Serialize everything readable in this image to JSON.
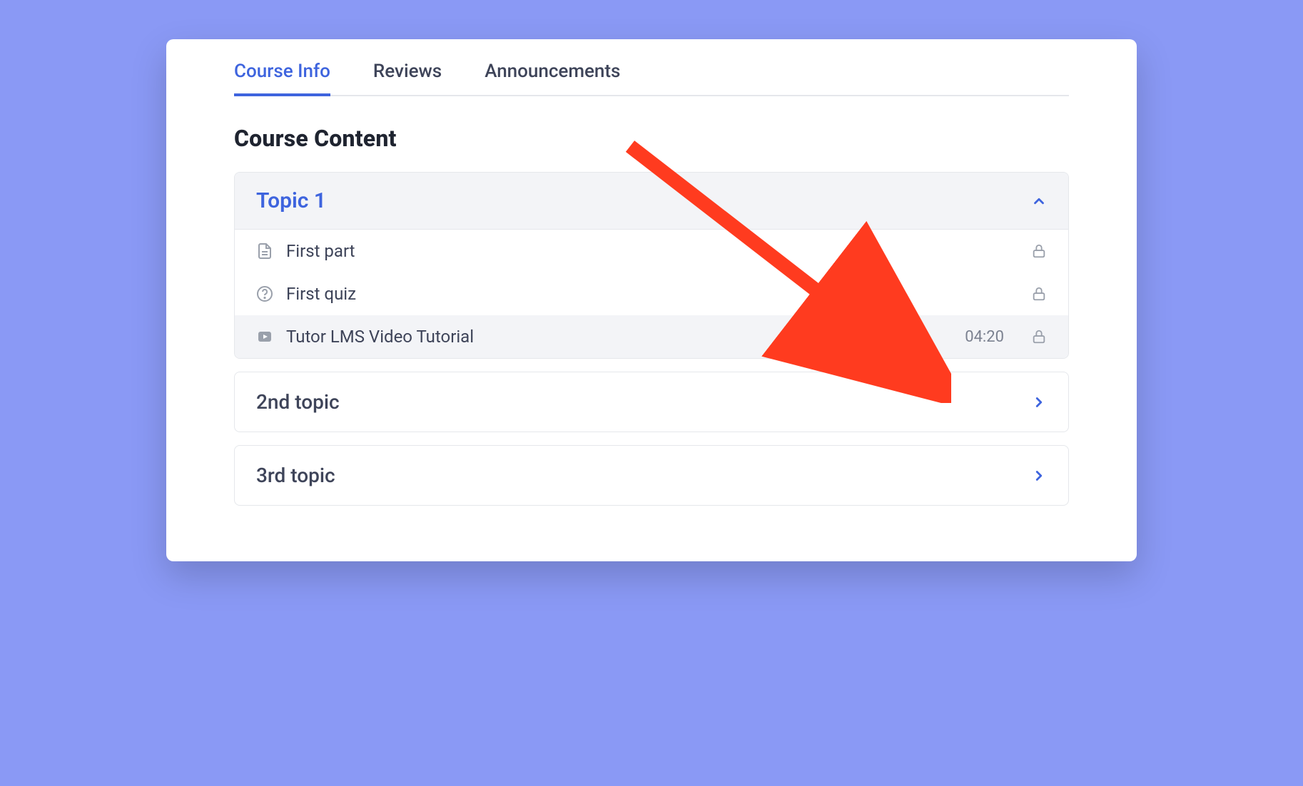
{
  "tabs": {
    "course_info": "Course Info",
    "reviews": "Reviews",
    "announcements": "Announcements"
  },
  "section_title": "Course Content",
  "topics": {
    "expanded": {
      "title": "Topic 1",
      "lessons": [
        {
          "label": "First part",
          "type": "document",
          "locked": true
        },
        {
          "label": "First quiz",
          "type": "quiz",
          "locked": true
        },
        {
          "label": "Tutor LMS Video Tutorial",
          "type": "video",
          "duration": "04:20",
          "locked": true
        }
      ]
    },
    "collapsed": [
      {
        "title": "2nd topic"
      },
      {
        "title": "3rd topic"
      }
    ]
  },
  "annotation": {
    "arrow_color": "#ff3b1f"
  }
}
